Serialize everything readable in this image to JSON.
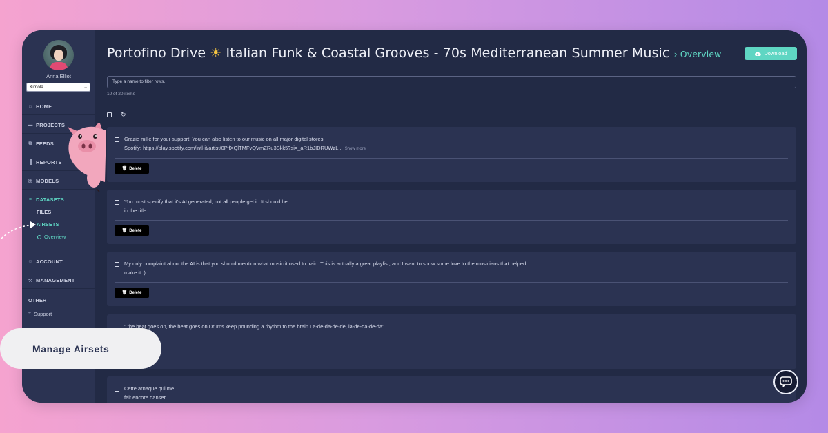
{
  "user": {
    "name": "Anna Elliot",
    "workspace": "Kimola"
  },
  "nav": {
    "home": "HOME",
    "projects": "PROJECTS",
    "feeds": "FEEDS",
    "reports": "REPORTS",
    "models": "MODELS",
    "datasets": "DATASETS",
    "files": "FILES",
    "airsets": "AIRSETS",
    "overview": "Overview",
    "account": "ACCOUNT",
    "management": "MANAGEMENT",
    "other": "OTHER",
    "support": "Support"
  },
  "page": {
    "title": "Portofino Drive",
    "title_rest": "Italian Funk & Coastal Grooves - 70s Mediterranean Summer Music",
    "breadcrumb": "Overview",
    "download_label": "Download"
  },
  "filter": {
    "placeholder": "Type a name to filter rows.",
    "count_text": "10 of 20 items"
  },
  "rows": [
    {
      "line1": "Grazie mille for your support! You can also listen to our music on all major digital stores:",
      "line2": "Spotify: https://play.spotify.com/intl-it/artist/0PifXQlTMFvQVmZRu3Skk5?si=_aR1bJIDRUWzL...",
      "more": "Show more",
      "delete": "Delete"
    },
    {
      "line1": "You must specify that it's AI generated, not all people get it. It should be",
      "line2": "in the title.",
      "delete": "Delete"
    },
    {
      "line1": "My only complaint about the AI is that you should mention what music it used to train. This is actually a great playlist, and I want to show some love to the musicians that helped",
      "line2": "make it :)",
      "delete": "Delete"
    },
    {
      "line1": "\" the beat goes on, the beat goes on Drums keep pounding a rhythm to the brain La-de-da-de-de, la-de-da-de-da\""
    },
    {
      "line1": "Cette arnaque qui me",
      "line2": "fait encore danser."
    }
  ],
  "overlay": {
    "badge": "Manage Airsets"
  },
  "colors": {
    "accent": "#5fd6c3",
    "panel": "#2b3352",
    "background": "#222a45"
  }
}
